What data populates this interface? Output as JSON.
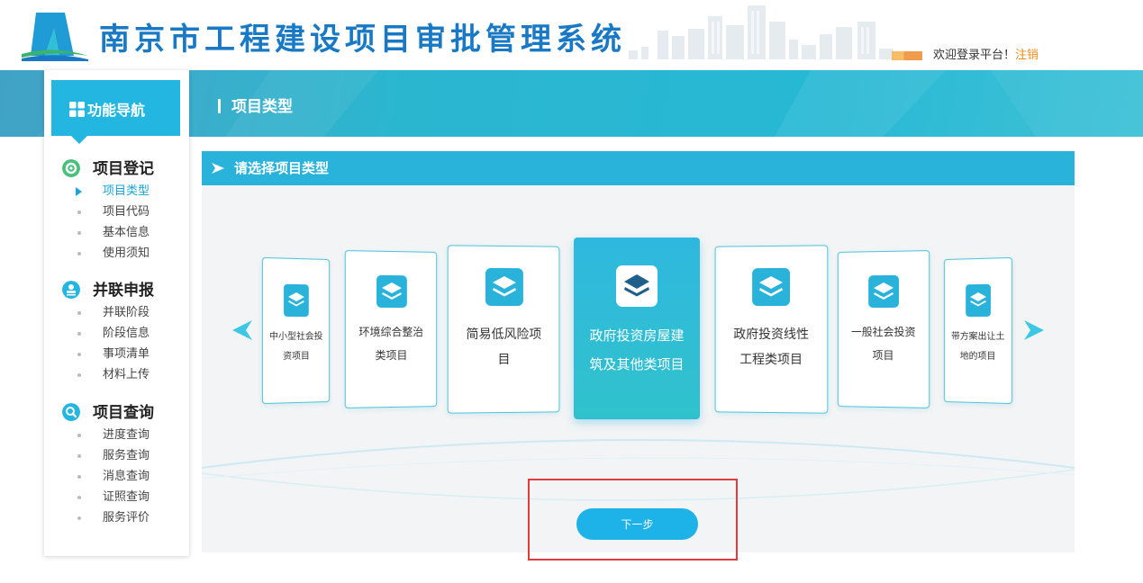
{
  "header": {
    "title": "南京市工程建设项目审批管理系统",
    "welcome": "欢迎登录平台！",
    "logout": "注销",
    "colors": {
      "title": "#1a79c4",
      "logout": "#f08c1a"
    }
  },
  "banner": {
    "heading": "项目类型"
  },
  "sidebar": {
    "nav_title": "功能导航",
    "groups": [
      {
        "title": "项目登记",
        "icon": "gear-icon",
        "color": "#48c07a",
        "items": [
          {
            "label": "项目类型",
            "active": true
          },
          {
            "label": "项目代码"
          },
          {
            "label": "基本信息"
          },
          {
            "label": "使用须知"
          }
        ]
      },
      {
        "title": "并联申报",
        "icon": "stamp-icon",
        "color": "#22b6e0",
        "items": [
          {
            "label": "并联阶段"
          },
          {
            "label": "阶段信息"
          },
          {
            "label": "事项清单"
          },
          {
            "label": "材料上传"
          }
        ]
      },
      {
        "title": "项目查询",
        "icon": "search-icon",
        "color": "#22b6e0",
        "items": [
          {
            "label": "进度查询"
          },
          {
            "label": "服务查询"
          },
          {
            "label": "消息查询"
          },
          {
            "label": "证照查询"
          },
          {
            "label": "服务评价"
          }
        ]
      }
    ]
  },
  "main": {
    "panel_title": "请选择项目类型",
    "cards": [
      {
        "label": "中小型社会投资项目",
        "selected": false
      },
      {
        "label": "环境综合整治类项目",
        "selected": false
      },
      {
        "label": "简易低风险项目",
        "selected": false
      },
      {
        "label": "政府投资房屋建筑及其他类项目",
        "selected": true
      },
      {
        "label": "政府投资线性工程类项目",
        "selected": false
      },
      {
        "label": "一般社会投资项目",
        "selected": false
      },
      {
        "label": "带方案出让土地的项目",
        "selected": false
      }
    ],
    "next_button": "下一步",
    "accent": "#2ab3da"
  }
}
